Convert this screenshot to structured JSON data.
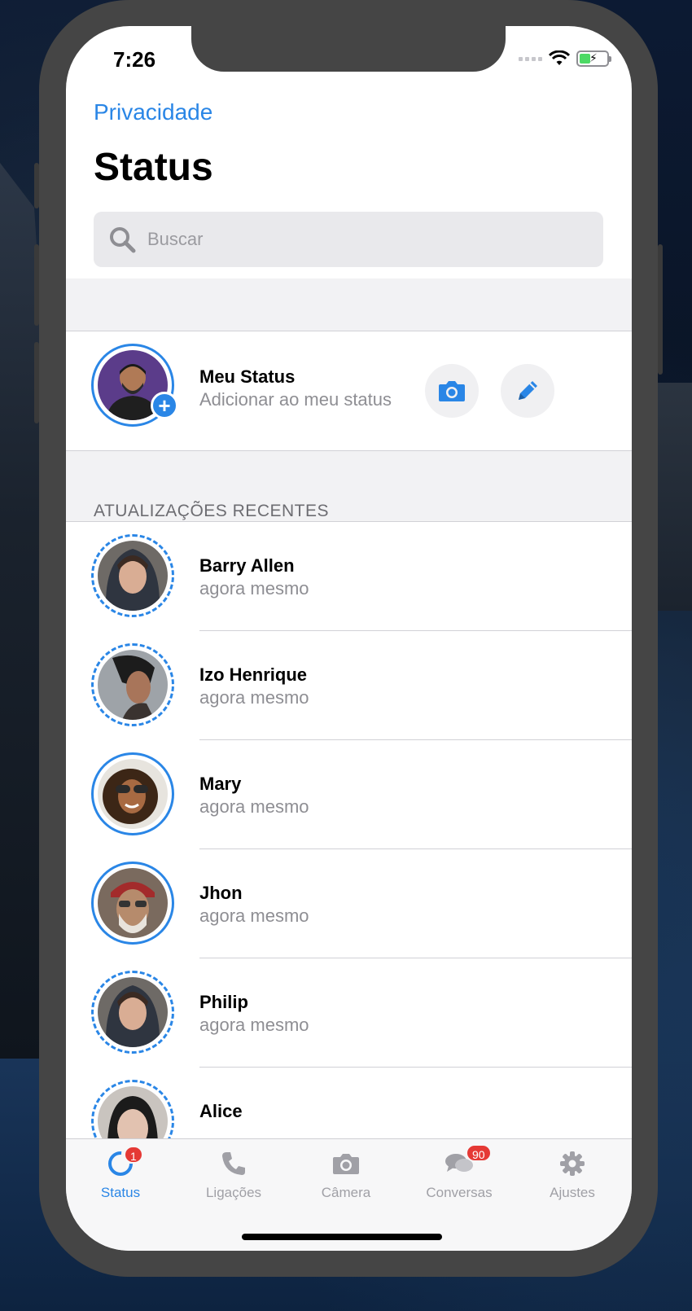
{
  "status_bar": {
    "time": "7:26"
  },
  "nav": {
    "back_link": "Privacidade",
    "title": "Status"
  },
  "search": {
    "placeholder": "Buscar"
  },
  "my_status": {
    "name": "Meu Status",
    "subtitle": "Adicionar ao meu status",
    "camera_icon": "camera-icon",
    "edit_icon": "pencil-icon"
  },
  "section": {
    "recent_header": "ATUALIZAÇÕES RECENTES"
  },
  "contacts": [
    {
      "name": "Barry Allen",
      "time": "agora mesmo"
    },
    {
      "name": "Izo Henrique",
      "time": "agora mesmo"
    },
    {
      "name": "Mary",
      "time": "agora mesmo"
    },
    {
      "name": "Jhon",
      "time": "agora mesmo"
    },
    {
      "name": "Philip",
      "time": "agora mesmo"
    },
    {
      "name": "Alice",
      "time": ""
    }
  ],
  "tabbar": {
    "tabs": [
      {
        "label": "Status",
        "icon": "status-icon",
        "badge": "1",
        "active": true
      },
      {
        "label": "Ligações",
        "icon": "phone-icon",
        "badge": "",
        "active": false
      },
      {
        "label": "Câmera",
        "icon": "camera-icon",
        "badge": "",
        "active": false
      },
      {
        "label": "Conversas",
        "icon": "chat-bubbles-icon",
        "badge": "90",
        "active": false
      },
      {
        "label": "Ajustes",
        "icon": "gear-icon",
        "badge": "",
        "active": false
      }
    ]
  },
  "colors": {
    "accent": "#2a86e6",
    "badge": "#e53935",
    "secondary_text": "#8e8e93",
    "band": "#f2f2f4"
  }
}
